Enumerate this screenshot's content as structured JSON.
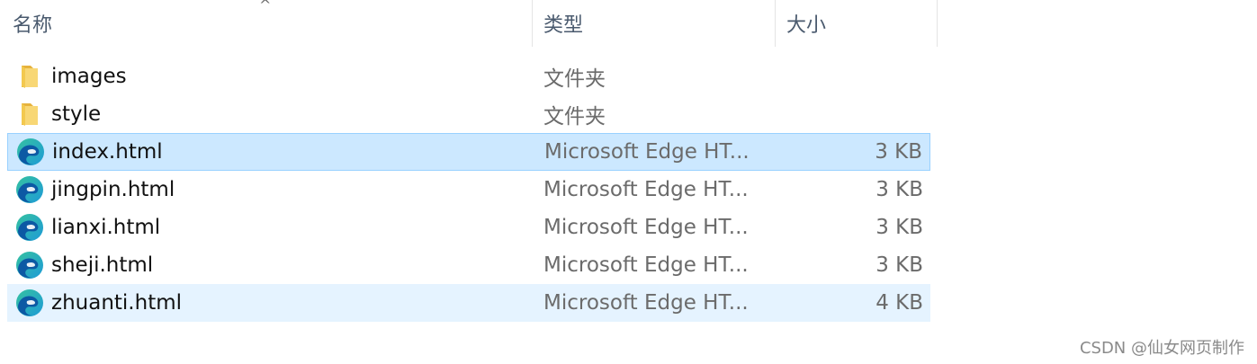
{
  "columns": {
    "name": "名称",
    "type": "类型",
    "size": "大小",
    "sort_indicator": "^"
  },
  "files": [
    {
      "name": "images",
      "type": "文件夹",
      "size": "",
      "icon": "folder-icon",
      "state": "normal"
    },
    {
      "name": "style",
      "type": "文件夹",
      "size": "",
      "icon": "folder-icon",
      "state": "normal"
    },
    {
      "name": "index.html",
      "type": "Microsoft Edge HT...",
      "size": "3 KB",
      "icon": "edge-icon",
      "state": "selected"
    },
    {
      "name": "jingpin.html",
      "type": "Microsoft Edge HT...",
      "size": "3 KB",
      "icon": "edge-icon",
      "state": "normal"
    },
    {
      "name": "lianxi.html",
      "type": "Microsoft Edge HT...",
      "size": "3 KB",
      "icon": "edge-icon",
      "state": "normal"
    },
    {
      "name": "sheji.html",
      "type": "Microsoft Edge HT...",
      "size": "3 KB",
      "icon": "edge-icon",
      "state": "normal"
    },
    {
      "name": "zhuanti.html",
      "type": "Microsoft Edge HT...",
      "size": "4 KB",
      "icon": "edge-icon",
      "state": "hover"
    }
  ],
  "colors": {
    "selected_bg": "#cce8ff",
    "selected_border": "#99d1ff",
    "hover_bg": "#e5f3ff",
    "folder_yellow": "#f8d775",
    "edge_blue": "#0c59a4",
    "edge_green": "#35c1a0"
  },
  "watermark": "CSDN @仙女网页制作"
}
